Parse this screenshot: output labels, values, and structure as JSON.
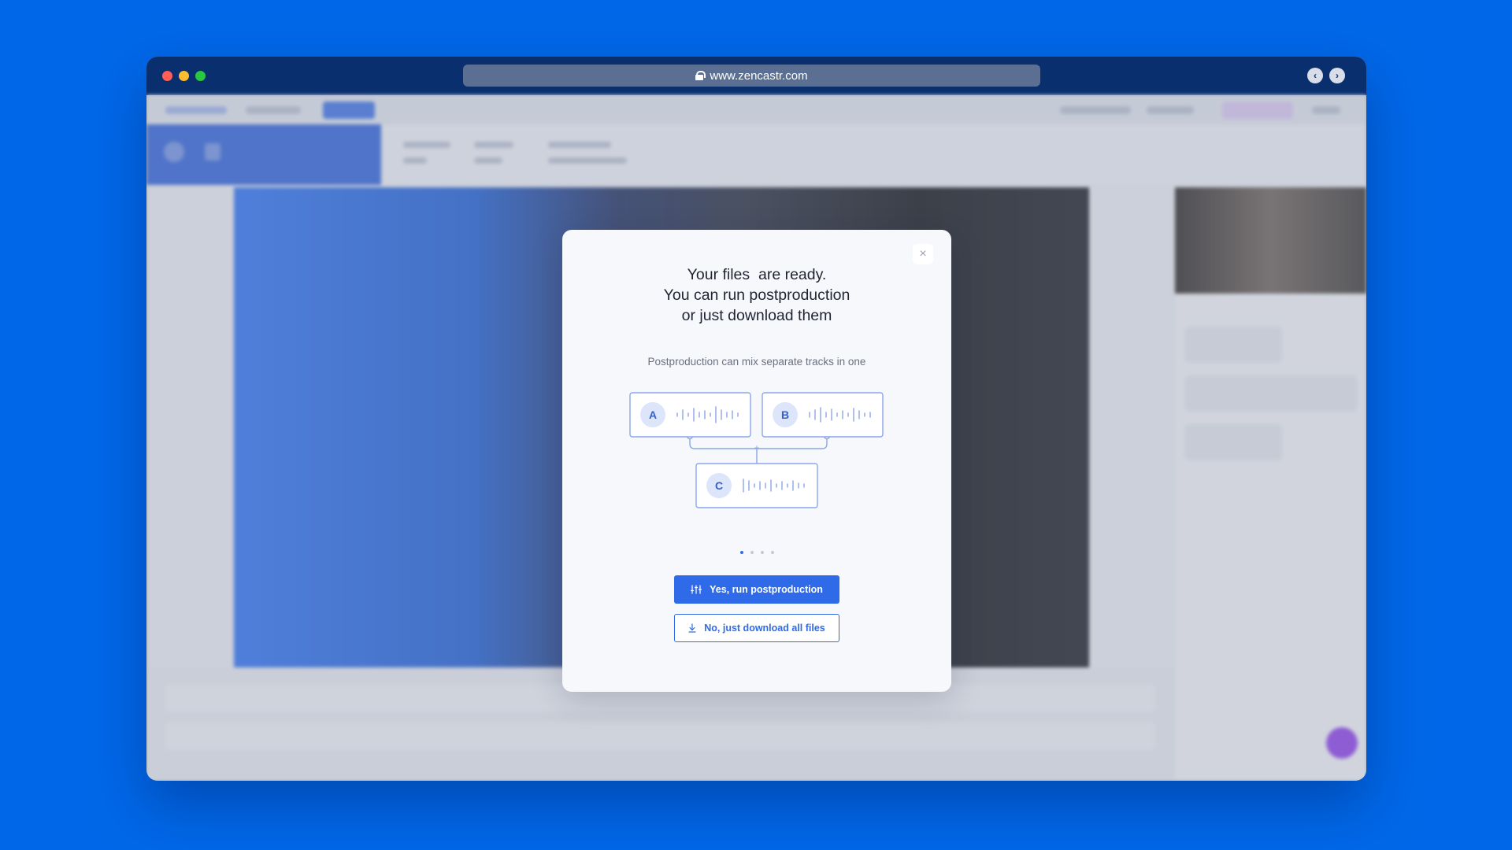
{
  "browser": {
    "url": "www.zencastr.com",
    "back_glyph": "‹",
    "forward_glyph": "›"
  },
  "modal": {
    "close_glyph": "×",
    "title_lines": [
      "Your files  are ready.",
      "You can run postproduction",
      "or just download them"
    ],
    "subtitle": "Postproduction can mix separate tracks in one",
    "tracks": [
      {
        "label": "A"
      },
      {
        "label": "B"
      },
      {
        "label": "C"
      }
    ],
    "mix_glyph": "+",
    "pagination": {
      "count": 4,
      "active": 1
    },
    "primary_button": {
      "label": "Yes, run postproduction",
      "icon": "sliders-icon"
    },
    "secondary_button": {
      "label": "No, just download all files",
      "icon": "download-icon"
    }
  },
  "colors": {
    "background": "#0068e8",
    "titlebar": "#0a2f6e",
    "accent": "#2f6be8",
    "track_chip": "#dde5fb"
  }
}
